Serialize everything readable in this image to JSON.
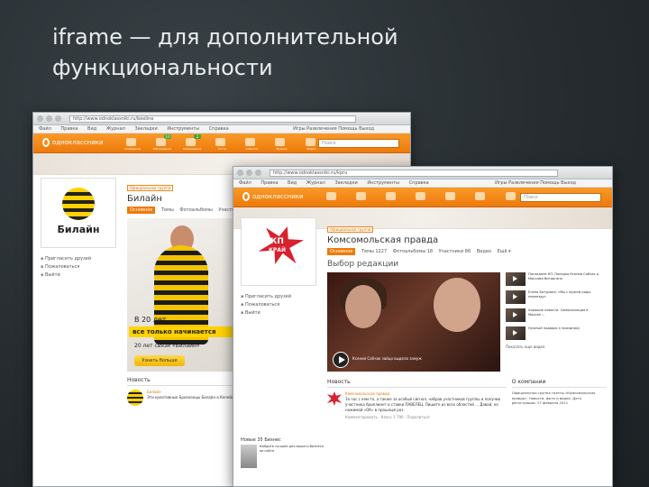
{
  "slide": {
    "title_line1": "iframe —  для дополнительной",
    "title_line2": "функциональности"
  },
  "win1": {
    "url": "http://www.odnoklassniki.ru/beeline",
    "menu": [
      "Файл",
      "Правка",
      "Вид",
      "Журнал",
      "Закладки",
      "Инструменты",
      "Справка"
    ],
    "menu_right": "Игры  Развлечения  Помощь  Выход",
    "site_logo": "одноклассники",
    "nav_icons": [
      {
        "icon": "mail-icon",
        "label": "Сообщения",
        "badge": ""
      },
      {
        "icon": "discussion-icon",
        "label": "Обсуждения",
        "badge": "10"
      },
      {
        "icon": "alert-icon",
        "label": "Оповещения",
        "badge": "2"
      },
      {
        "icon": "guests-icon",
        "label": "Гости",
        "badge": ""
      },
      {
        "icon": "events-icon",
        "label": "События",
        "badge": ""
      },
      {
        "icon": "music-icon",
        "label": "Музыка",
        "badge": ""
      },
      {
        "icon": "video-icon",
        "label": "Видео",
        "badge": ""
      }
    ],
    "search_placeholder": "Поиск",
    "brand_name": "Билайн",
    "side_links": [
      "Пригласить друзей",
      "Пожаловаться",
      "Выйти"
    ],
    "tag": "Официальная группа",
    "group_title": "Билайн",
    "tabs": [
      "Основное",
      "Темы",
      "Фотоальбомы",
      "Участники"
    ],
    "promo_line1": "В 20 лет",
    "promo_line2": "все только начинается",
    "promo_line3": "20 лет связи «Билайн»",
    "promo_cta": "Узнать больше",
    "news_head": "Новость",
    "news_who": "Билайн",
    "news_text": "Эти креативные Бризнанцы Билайн в Копейске. Из каждого упавший лайк ... Путешествуйте вместе с «Билайн» за 5,95"
  },
  "win2": {
    "url": "http://www.odnoklassniki.ru/kpru",
    "menu": [
      "Файл",
      "Правка",
      "Вид",
      "Журнал",
      "Закладки",
      "Инструменты",
      "Справка"
    ],
    "menu_right": "Игры  Развлечения  Помощь  Выход",
    "site_logo": "одноклассники",
    "search_placeholder": "Поиск",
    "logo_text1": "КП",
    "logo_text2": "КРАЙ",
    "side_links": [
      "Пригласить друзей",
      "Пожаловаться",
      "Выйти"
    ],
    "tag": "Официальная группа",
    "group_title": "Комсомольская правда",
    "tabs": [
      "Основное",
      "Темы 1227",
      "Фотоальбомы 18",
      "Участники 86",
      "Видео",
      "Ещё ▾"
    ],
    "section_title": "Выбор редакции",
    "video_caption": "Ксения Собчак зайцо выдела замуж",
    "video_list": [
      "Последнее КП. Поездка Ксении Собчак и Максима Виторгана",
      "Елена Батурина: «Мы с мужем рады переезду»",
      "Хорошие новости. Самоизоляция в Москве ...",
      "Нужный подарок к празднику"
    ],
    "video_more": "Показать еще видео",
    "news_head": "Новость",
    "news_who": "Комсомольская правда",
    "news_text": "За час с кем-то, а также за особый сигнал, набрав участников группы и получив участника бриллиант и ставки ПАВЕЛЕЦ. Пишите из всех областей ... Давай, не нажимай «ОК» в прошлый раз.",
    "news_actions": "Комментировать · Класс 1 790 · Поделиться",
    "about_head": "О компании",
    "about_text": "Официальная группа газеты «Комсомольская правда». Новости, фото и видео. Дата регистрации: 27 февраля 2011",
    "lower_label": "Новые 35 Бизнес",
    "lower_text": "Найдите лучшее для вашего бизнеса на сайте"
  }
}
